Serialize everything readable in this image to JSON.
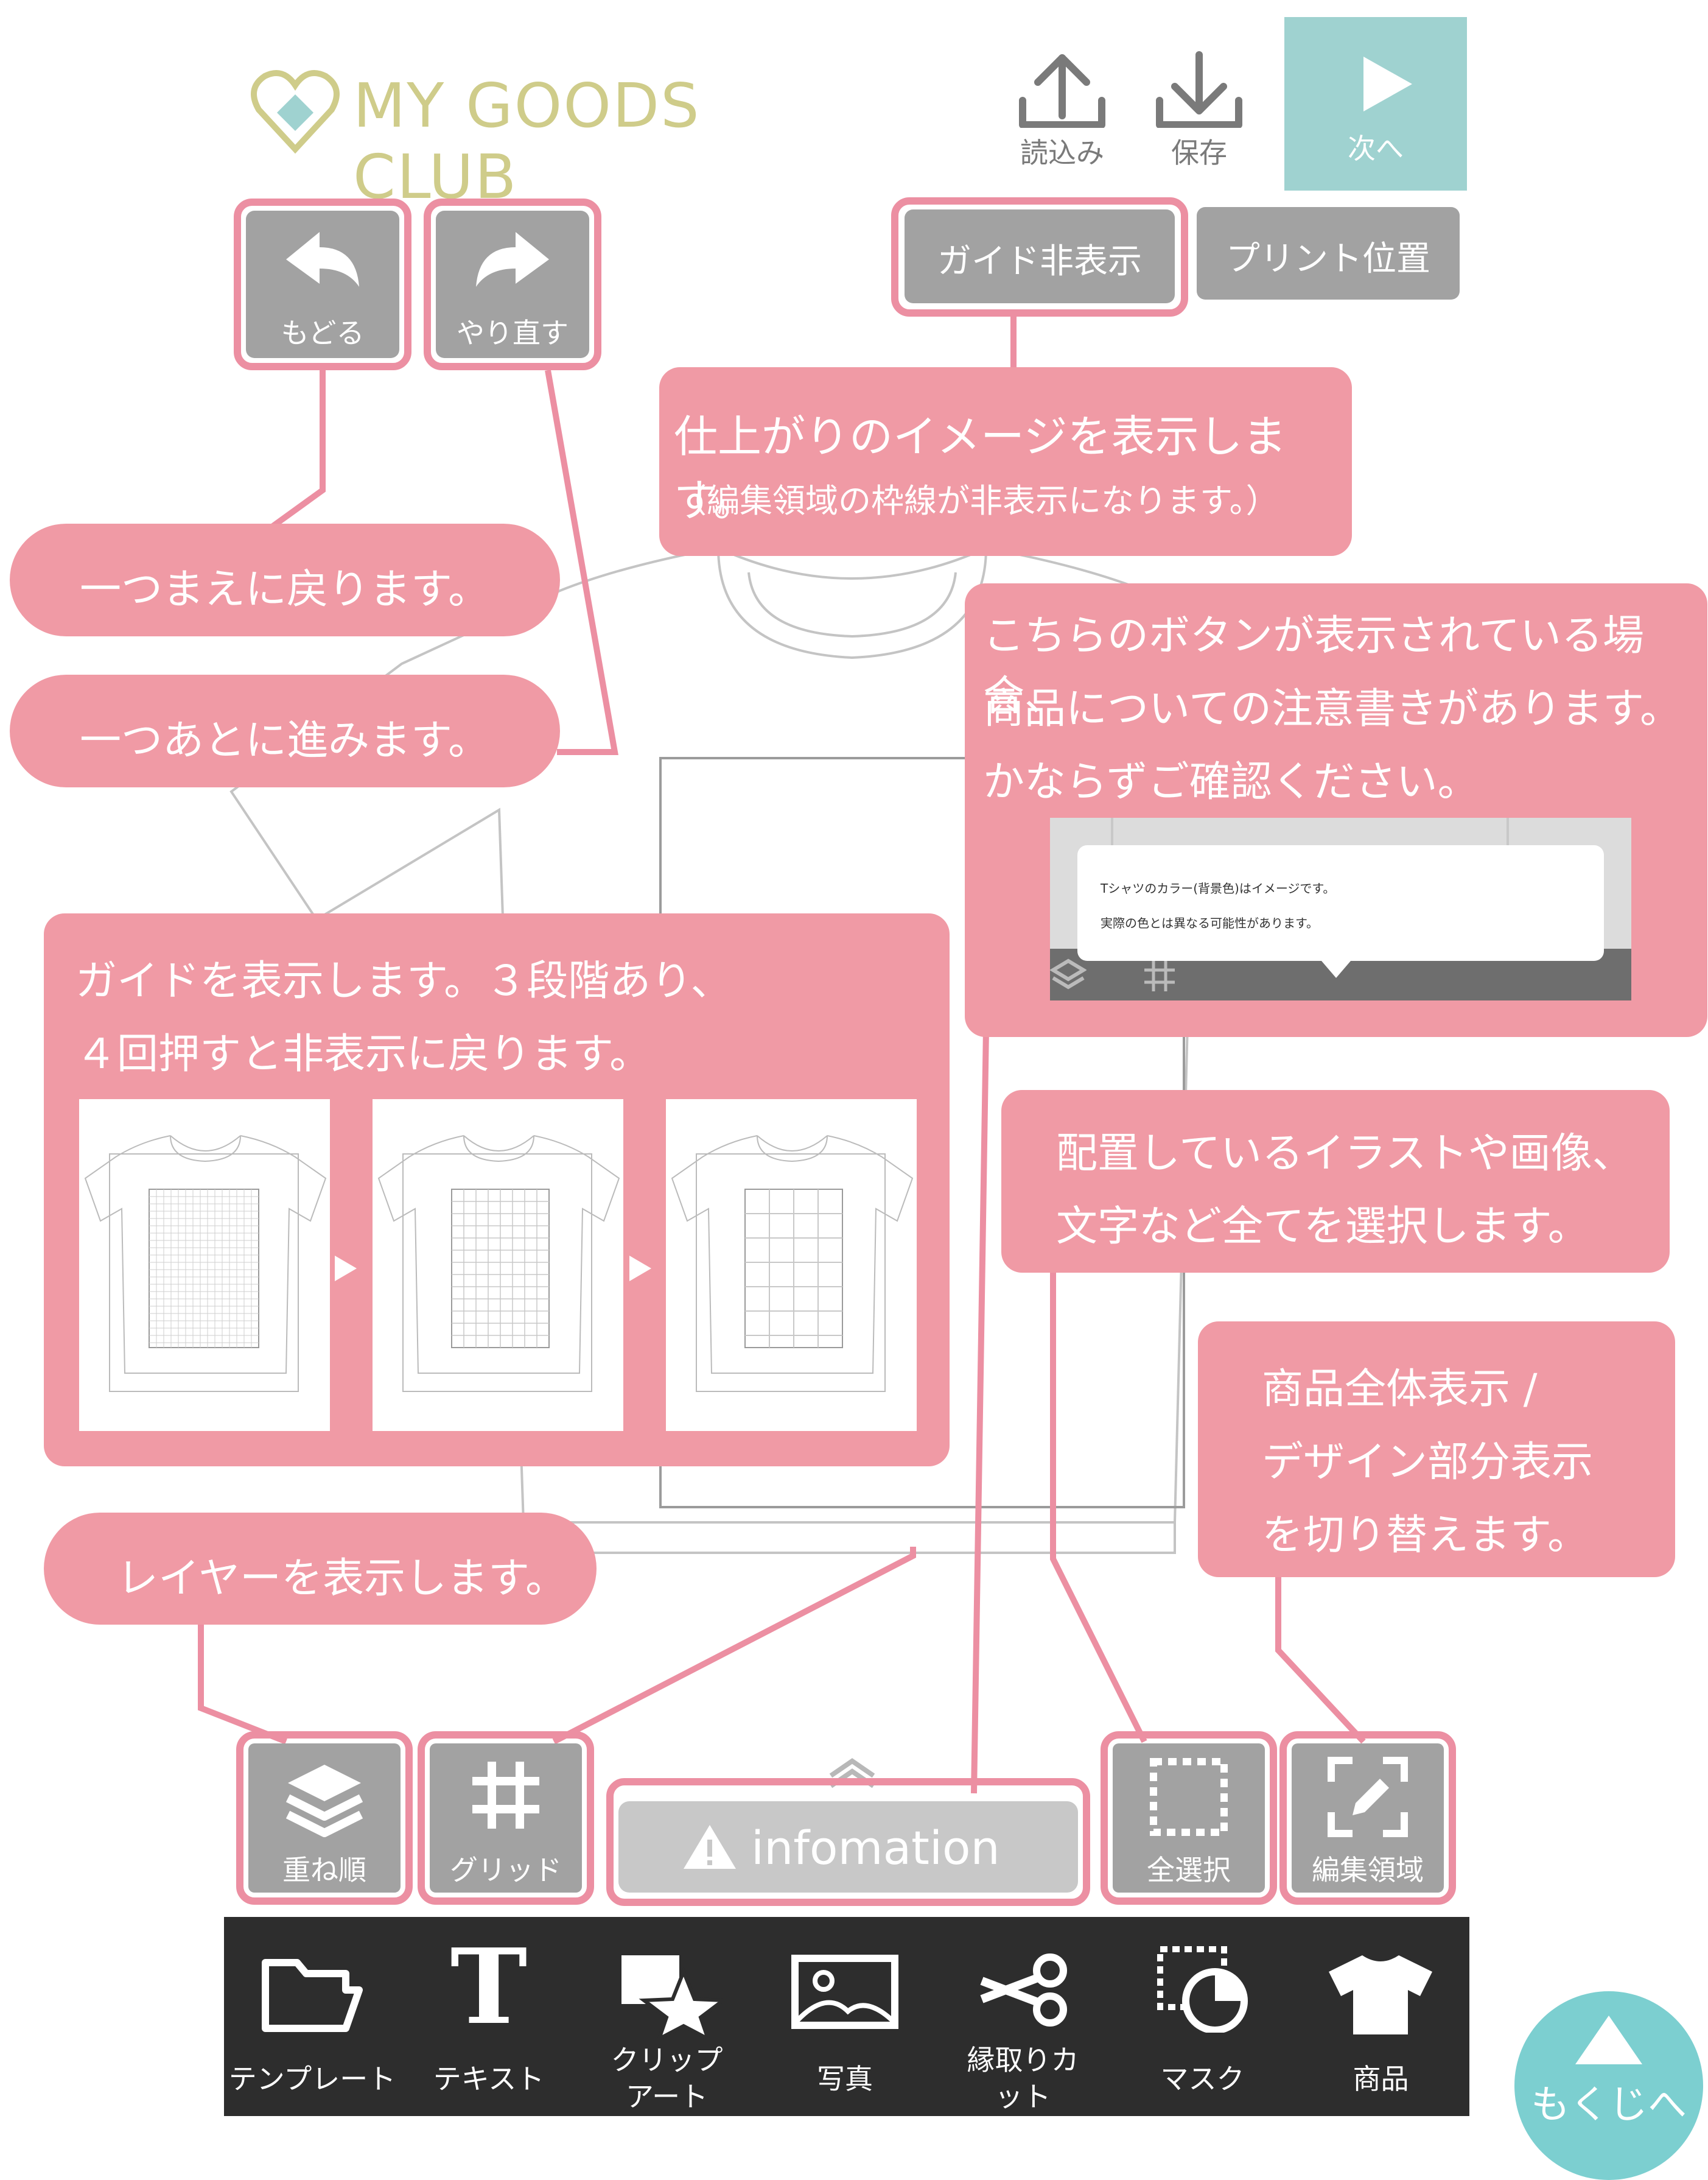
{
  "header": {
    "logo_text": "MY GOODS CLUB",
    "load_label": "読込み",
    "save_label": "保存",
    "next_label": "次へ"
  },
  "top_buttons": {
    "undo_label": "もどる",
    "redo_label": "やり直す",
    "guide_hide_label": "ガイド非表示",
    "print_position_label": "プリント位置"
  },
  "callouts": {
    "guide_hide_line1": "仕上がりのイメージを表示します。",
    "guide_hide_line2": "（編集領域の枠線が非表示になります。）",
    "undo": "一つまえに戻ります。",
    "redo": "一つあとに進みます。",
    "info_line1": "こちらのボタンが表示されている場合、",
    "info_line2": "商品についての注意書きがあります。",
    "info_line3": "かならずご確認ください。",
    "grid_line1": "ガイドを表示します。３段階あり、",
    "grid_line2": "４回押すと非表示に戻ります。",
    "select_all_line1": "配置しているイラストや画像、",
    "select_all_line2": "文字など全てを選択します。",
    "edit_area_line1": "商品全体表示 /",
    "edit_area_line2": "デザイン部分表示",
    "edit_area_line3": "を切り替えます。",
    "layer": "レイヤーを表示します。"
  },
  "info_preview": {
    "line1": "Tシャツのカラー(背景色)はイメージです。",
    "line2": "実際の色とは異なる可能性があります。"
  },
  "bottom_buttons": {
    "layer_label": "重ね順",
    "grid_label": "グリッド",
    "info_label": "infomation",
    "select_all_label": "全選択",
    "edit_area_label": "編集領域"
  },
  "toolbar": [
    {
      "label": "テンプレート",
      "icon": "folder-icon"
    },
    {
      "label": "テキスト",
      "icon": "text-icon"
    },
    {
      "label": "クリップアート",
      "icon": "clipart-icon"
    },
    {
      "label": "写真",
      "icon": "photo-icon"
    },
    {
      "label": "縁取りカット",
      "icon": "scissors-icon"
    },
    {
      "label": "マスク",
      "icon": "mask-icon"
    },
    {
      "label": "商品",
      "icon": "tshirt-icon"
    }
  ],
  "back_to_top_label": "もくじへ",
  "colors": {
    "accent_pink": "#f09aa5",
    "highlight_pink": "#ec8fa2",
    "teal": "#9fd2d0",
    "button_gray": "#a2a2a2",
    "toolbar_bg": "#2d2d2d"
  }
}
